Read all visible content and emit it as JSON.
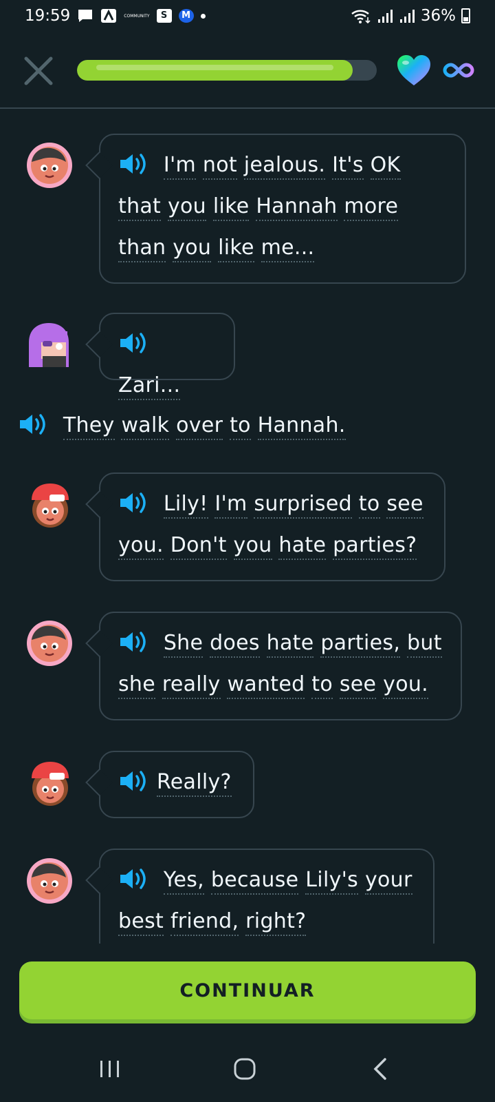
{
  "status_bar": {
    "time": "19:59",
    "notification_tiny_text": "COMMUNITY",
    "notif_s": "S",
    "notif_m": "M",
    "battery": "36%"
  },
  "header": {
    "progress_percent": 92,
    "hearts": "infinite"
  },
  "messages": [
    {
      "type": "dialogue",
      "character": "zari-icon",
      "text": [
        "I'm",
        "not",
        "jealous.",
        "It's",
        "OK",
        "that",
        "you",
        "like",
        "Hannah",
        "more",
        "than",
        "you",
        "like",
        "me..."
      ]
    },
    {
      "type": "dialogue",
      "character": "lily-icon",
      "text": [
        "Zari..."
      ]
    },
    {
      "type": "narration",
      "text": [
        "They",
        "walk",
        "over",
        "to",
        "Hannah."
      ]
    },
    {
      "type": "dialogue",
      "character": "hannah-icon",
      "text": [
        "Lily!",
        "I'm",
        "surprised",
        "to",
        "see",
        "you.",
        "Don't",
        "you",
        "hate",
        "parties?"
      ]
    },
    {
      "type": "dialogue",
      "character": "zari-icon",
      "text": [
        "She",
        "does",
        "hate",
        "parties,",
        "but",
        "she",
        "really",
        "wanted",
        "to",
        "see",
        "you."
      ]
    },
    {
      "type": "dialogue",
      "character": "hannah-icon",
      "text": [
        "Really?"
      ]
    },
    {
      "type": "dialogue",
      "character": "zari-icon",
      "text": [
        "Yes,",
        "because",
        "Lily's",
        "your",
        "best",
        "friend,",
        "right?"
      ]
    }
  ],
  "continue_label": "CONTINUAR",
  "colors": {
    "background": "#131f24",
    "accent_green": "#93d333",
    "speaker_blue": "#1cb0f6",
    "border": "#37464f"
  }
}
